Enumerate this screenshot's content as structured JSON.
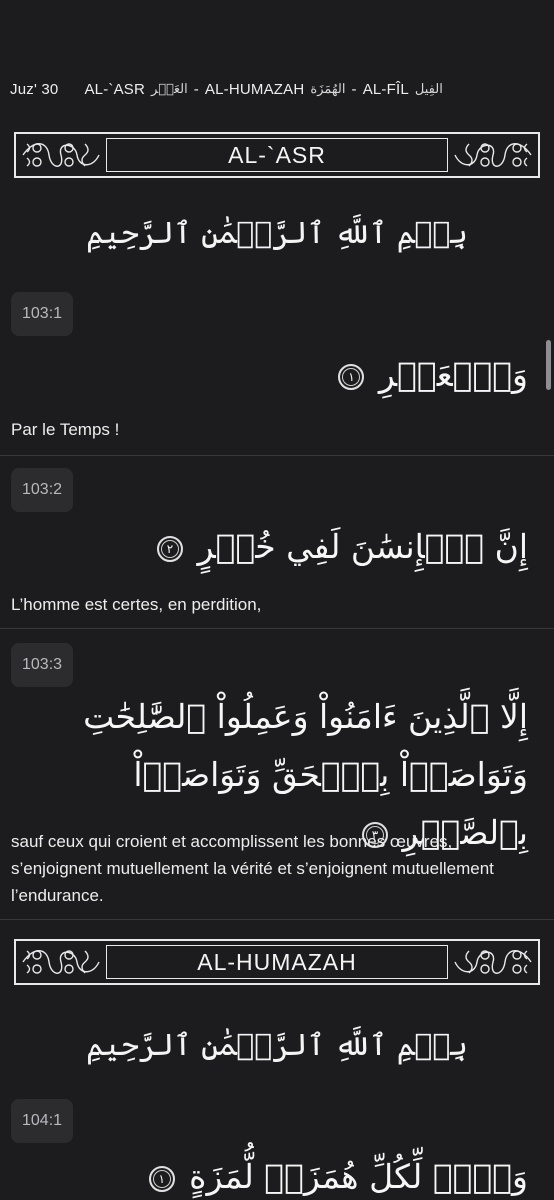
{
  "header": {
    "juz": "Juz' 30",
    "segments": [
      {
        "name": "AL-`ASR",
        "arabic": "العَصۡر"
      },
      {
        "name": "AL-HUMAZAH",
        "arabic": "الهُمَزَة"
      },
      {
        "name": "AL-FÎL",
        "arabic": "الفِيل"
      }
    ],
    "separator": "-"
  },
  "surahs": [
    {
      "title": "AL-`ASR",
      "bismillah": "بِسۡمِ ٱللَّهِ ٱلرَّحۡمَٰنِ ٱلرَّحِيمِ",
      "verses": [
        {
          "ref": "103:1",
          "arabic": "وَٱلۡعَصۡرِ",
          "mark": "١",
          "translation": "Par le Temps !"
        },
        {
          "ref": "103:2",
          "arabic": "إِنَّ ٱلۡإِنسَٰنَ لَفِي خُسۡرٍ",
          "mark": "٢",
          "translation": "L’homme est certes, en perdition,"
        },
        {
          "ref": "103:3",
          "arabic": "إِلَّا ٱلَّذِينَ ءَامَنُواْ وَعَمِلُواْ ٱلصَّٰلِحَٰتِ وَتَوَاصَوۡاْ بِٱلۡحَقِّ وَتَوَاصَوۡاْ بِٱلصَّبۡرِ",
          "mark": "٣",
          "translation": "sauf ceux qui croient et accomplissent les bonnes œuvres, s’enjoignent mutuellement la vérité et s’enjoignent mutuellement l’endurance."
        }
      ]
    },
    {
      "title": "AL-HUMAZAH",
      "bismillah": "بِسۡمِ ٱللَّهِ ٱلرَّحۡمَٰنِ ٱلرَّحِيمِ",
      "verses": [
        {
          "ref": "104:1",
          "arabic": "وَيۡلٞ لِّكُلِّ هُمَزَةٖ لُّمَزَةٍ",
          "mark": "١",
          "translation": ""
        }
      ]
    }
  ],
  "colors": {
    "background": "#1c1c1e",
    "badge": "#2c2c2e",
    "divider": "#38383a",
    "text": "#f2f2f2"
  }
}
